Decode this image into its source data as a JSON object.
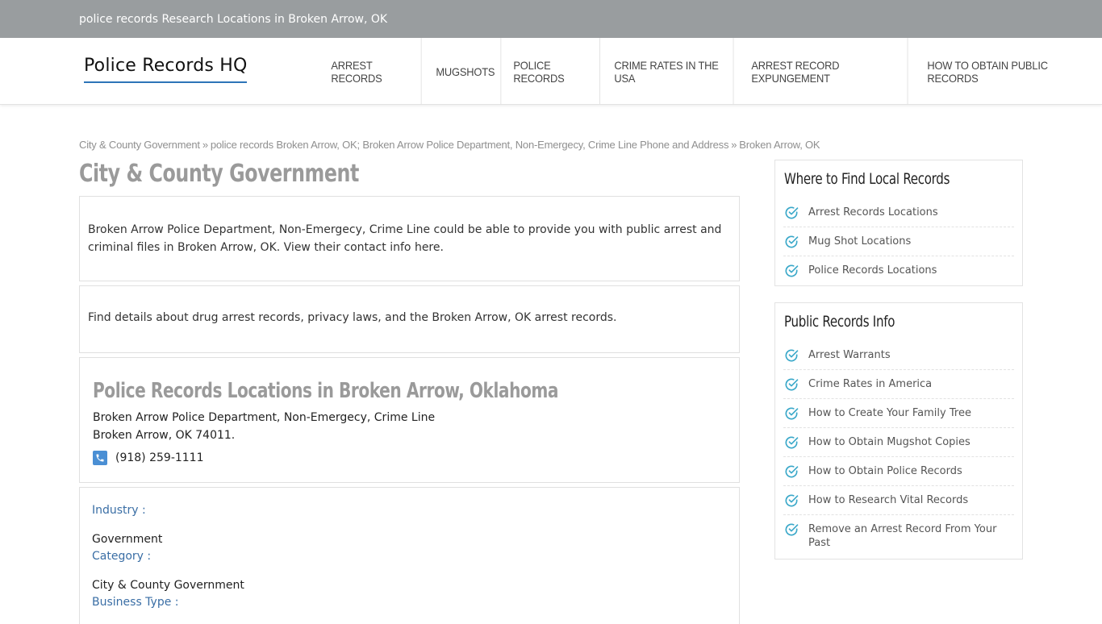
{
  "topbar": {
    "text": "police records Research Locations in Broken Arrow, OK"
  },
  "logo": {
    "text": "Police Records HQ"
  },
  "nav": {
    "items": [
      {
        "label": "ARREST RECORDS"
      },
      {
        "label": "MUGSHOTS"
      },
      {
        "label": "POLICE RECORDS"
      },
      {
        "label": "CRIME RATES IN THE USA"
      },
      {
        "label": "ARREST RECORD EXPUNGEMENT"
      },
      {
        "label": "HOW TO OBTAIN PUBLIC RECORDS"
      }
    ]
  },
  "breadcrumb": {
    "items": [
      "City & County Government",
      "police records Broken Arrow, OK; Broken Arrow Police Department, Non-Emergecy, Crime Line Phone and Address",
      "Broken Arrow, OK"
    ],
    "separator": "»"
  },
  "page_title": "City & County Government",
  "intro": {
    "paragraph1": "Broken Arrow Police Department, Non-Emergecy, Crime Line could be able to provide you with public arrest and criminal files in Broken Arrow, OK. View their contact info here.",
    "paragraph2": "Find details about drug arrest records, privacy laws, and the Broken Arrow, OK arrest records."
  },
  "location": {
    "title": "Police Records Locations in Broken Arrow, Oklahoma",
    "name": "Broken Arrow Police Department, Non-Emergecy, Crime Line",
    "address": "Broken Arrow, OK 74011.",
    "phone": "(918) 259-1111"
  },
  "details": {
    "industry_label": "Industry :",
    "industry_value": "Government",
    "category_label": "Category :",
    "category_value": "City & County Government",
    "business_type_label": "Business Type :"
  },
  "sidebar": {
    "widget1": {
      "title": "Where to Find Local Records",
      "items": [
        "Arrest Records Locations",
        "Mug Shot Locations",
        "Police Records Locations"
      ]
    },
    "widget2": {
      "title": "Public Records Info",
      "items": [
        "Arrest Warrants",
        "Crime Rates in America",
        "How to Create Your Family Tree",
        "How to Obtain Mugshot Copies",
        "How to Obtain Police Records",
        "How to Research Vital Records",
        "Remove an Arrest Record From Your Past"
      ]
    }
  },
  "colors": {
    "topbar_bg": "#999d9f",
    "logo_underline": "#2d74b8",
    "label_blue": "#3a6ea5",
    "check_teal": "#3aa8c9",
    "phone_icon_bg": "#4a8fd4"
  }
}
